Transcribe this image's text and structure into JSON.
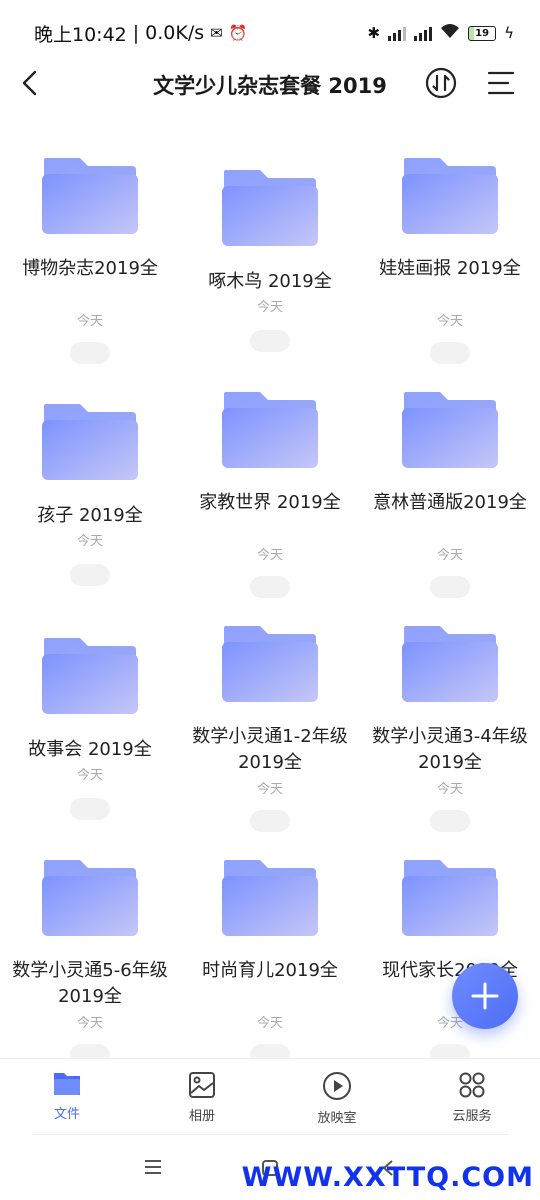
{
  "status_bar": {
    "time": "晚上10:42",
    "network_speed": "0.0K/s",
    "battery": "19"
  },
  "header": {
    "title": "文学少儿杂志套餐 2019"
  },
  "folders": [
    {
      "name": "博物杂志2019全",
      "date": "今天"
    },
    {
      "name": "啄木鸟 2019全",
      "date": "今天"
    },
    {
      "name": "娃娃画报 2019全",
      "date": "今天"
    },
    {
      "name": "孩子 2019全",
      "date": "今天"
    },
    {
      "name": "家教世界 2019全",
      "date": "今天"
    },
    {
      "name": "意林普通版2019全",
      "date": "今天"
    },
    {
      "name": "故事会 2019全",
      "date": "今天"
    },
    {
      "name": "数学小灵通1-2年级 2019全",
      "date": "今天"
    },
    {
      "name": "数学小灵通3-4年级 2019全",
      "date": "今天"
    },
    {
      "name": "数学小灵通5-6年级 2019全",
      "date": "今天"
    },
    {
      "name": "时尚育儿2019全",
      "date": "今天"
    },
    {
      "name": "现代家长2019全",
      "date": "今天"
    }
  ],
  "bottom_nav": [
    {
      "label": "文件",
      "icon": "folder-icon",
      "active": true
    },
    {
      "label": "相册",
      "icon": "photo-icon",
      "active": false
    },
    {
      "label": "放映室",
      "icon": "play-icon",
      "active": false
    },
    {
      "label": "云服务",
      "icon": "grid-icon",
      "active": false
    }
  ],
  "watermark": "WWW.XXTTQ.COM",
  "colors": {
    "accent": "#4a6cf7",
    "folder_light": "#a9b8ff",
    "folder_dark": "#7b8ff5"
  }
}
